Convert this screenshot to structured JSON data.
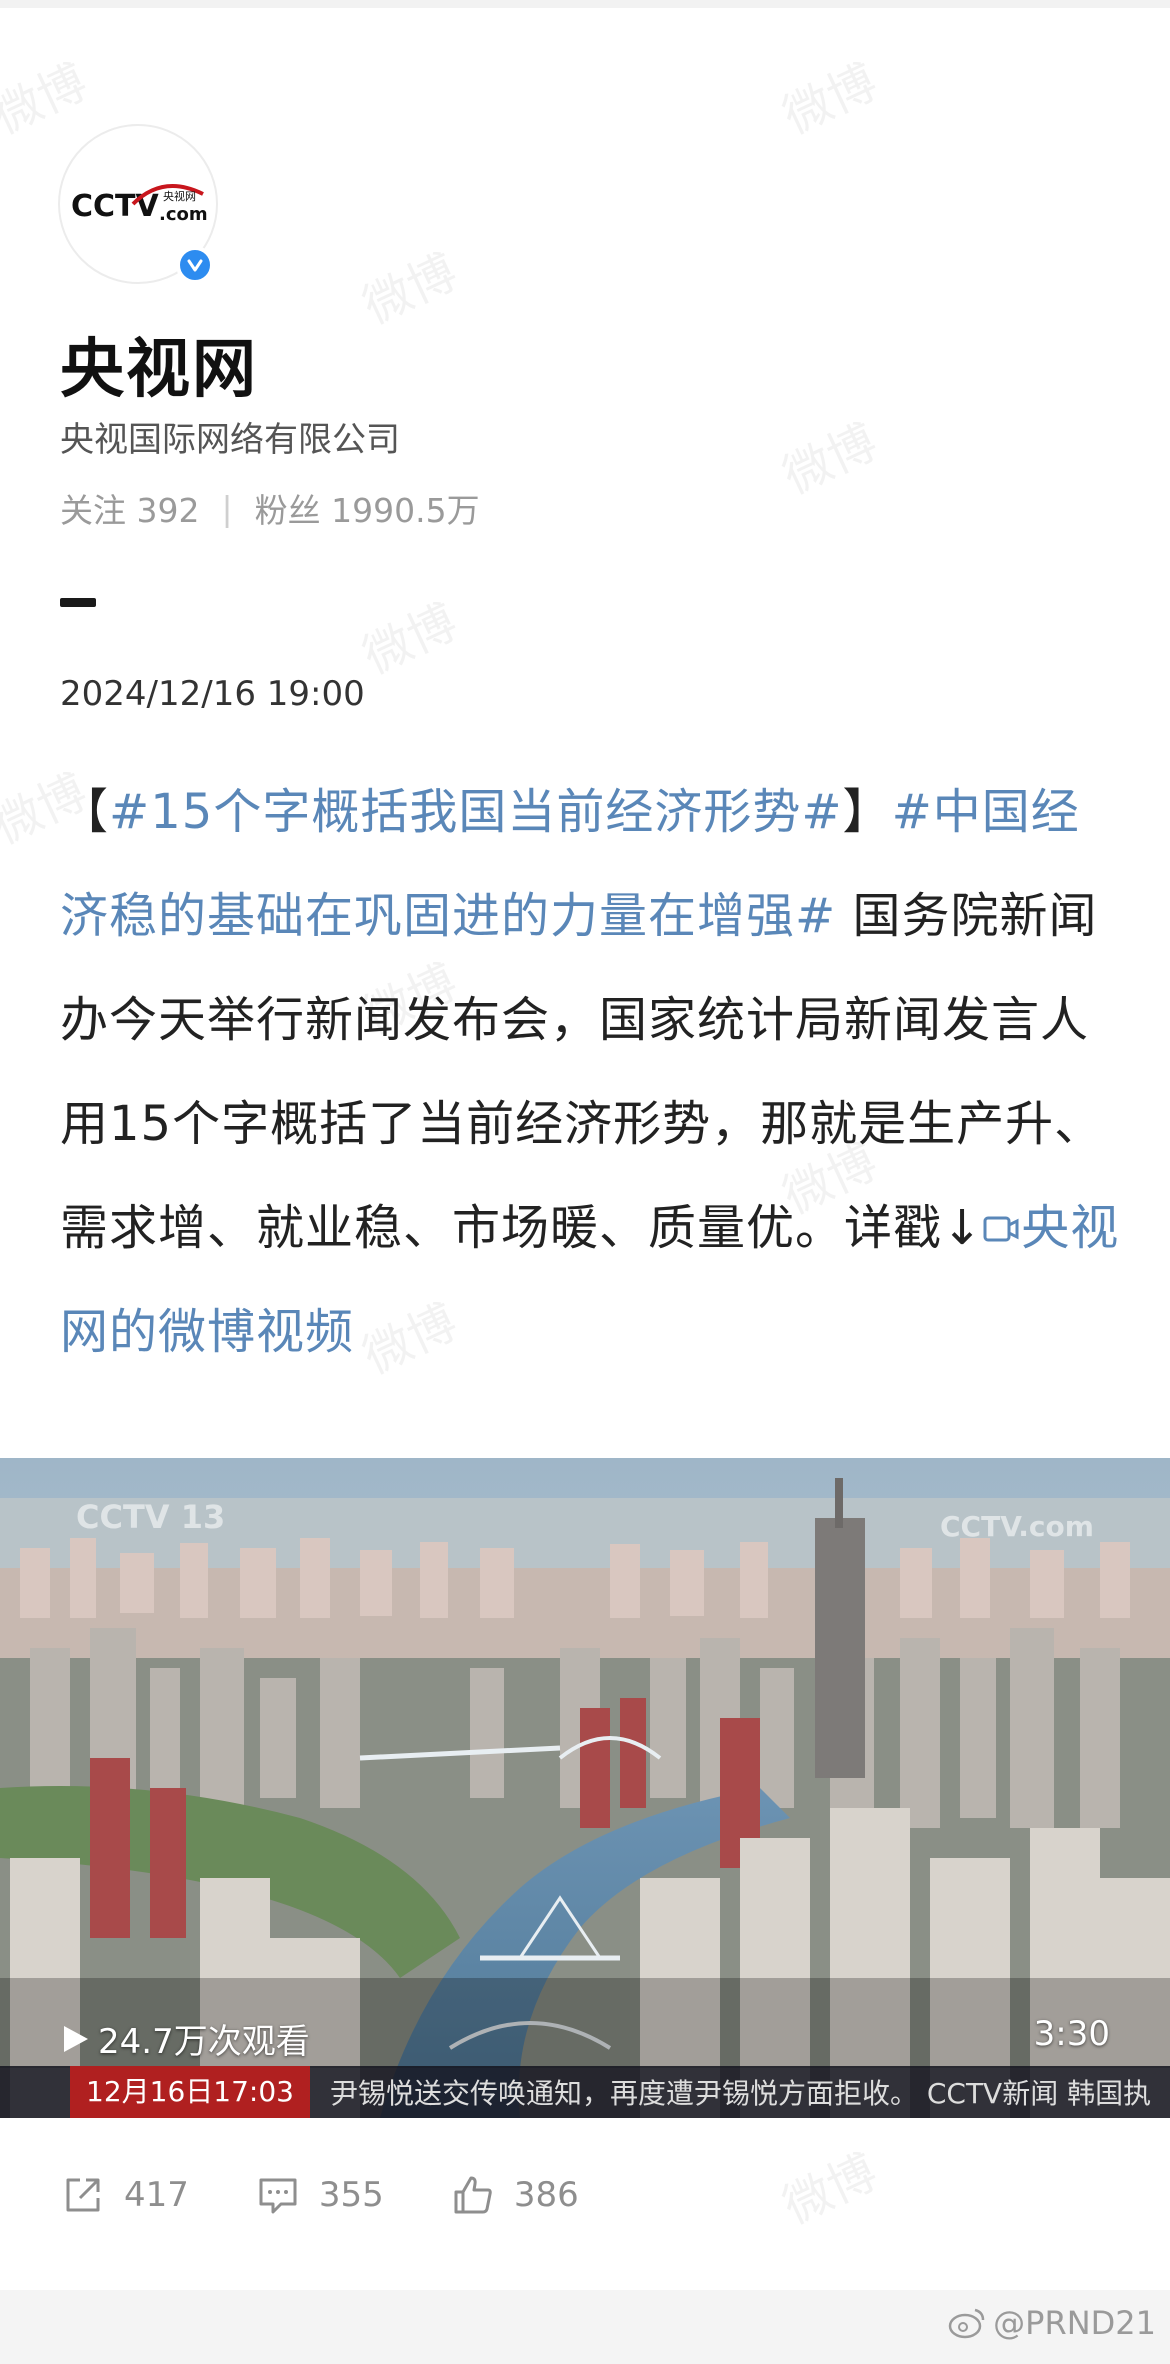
{
  "profile": {
    "name": "央视网",
    "organization": "央视国际网络有限公司",
    "following_label": "关注",
    "following_count": "392",
    "followers_label": "粉丝",
    "followers_count": "1990.5万",
    "avatar_text": "CCTV.com 央视网"
  },
  "post": {
    "date": "2024/12/16 19:00",
    "bracket_open": "【",
    "tag1": "#15个字概括我国当前经济形势#",
    "bracket_close": "】",
    "tag2": "#中国经济稳的基础在巩固进的力量在增强#",
    "body": " 国务院新闻办今天举行新闻发布会，国家统计局新闻发言人用15个字概括了当前经济形势，那就是生产升、需求增、就业稳、市场暖、质量优。详戳↓",
    "video_link_icon": "video-icon",
    "video_link": "央视网的微博视频"
  },
  "video": {
    "views": "24.7万次观看",
    "duration": "3:30",
    "ticker_time": "12月16日17:03",
    "ticker_text": "尹锡悦送交传唤通知，再度遭尹锡悦方面拒收。  CCTV新闻  韩国执"
  },
  "actions": {
    "share_count": "417",
    "comment_count": "355",
    "like_count": "386"
  },
  "footer": {
    "handle": "@PRND21"
  },
  "colors": {
    "link": "#5a87b8",
    "verified": "#2d8cf0",
    "muted": "#9a9a9a"
  }
}
